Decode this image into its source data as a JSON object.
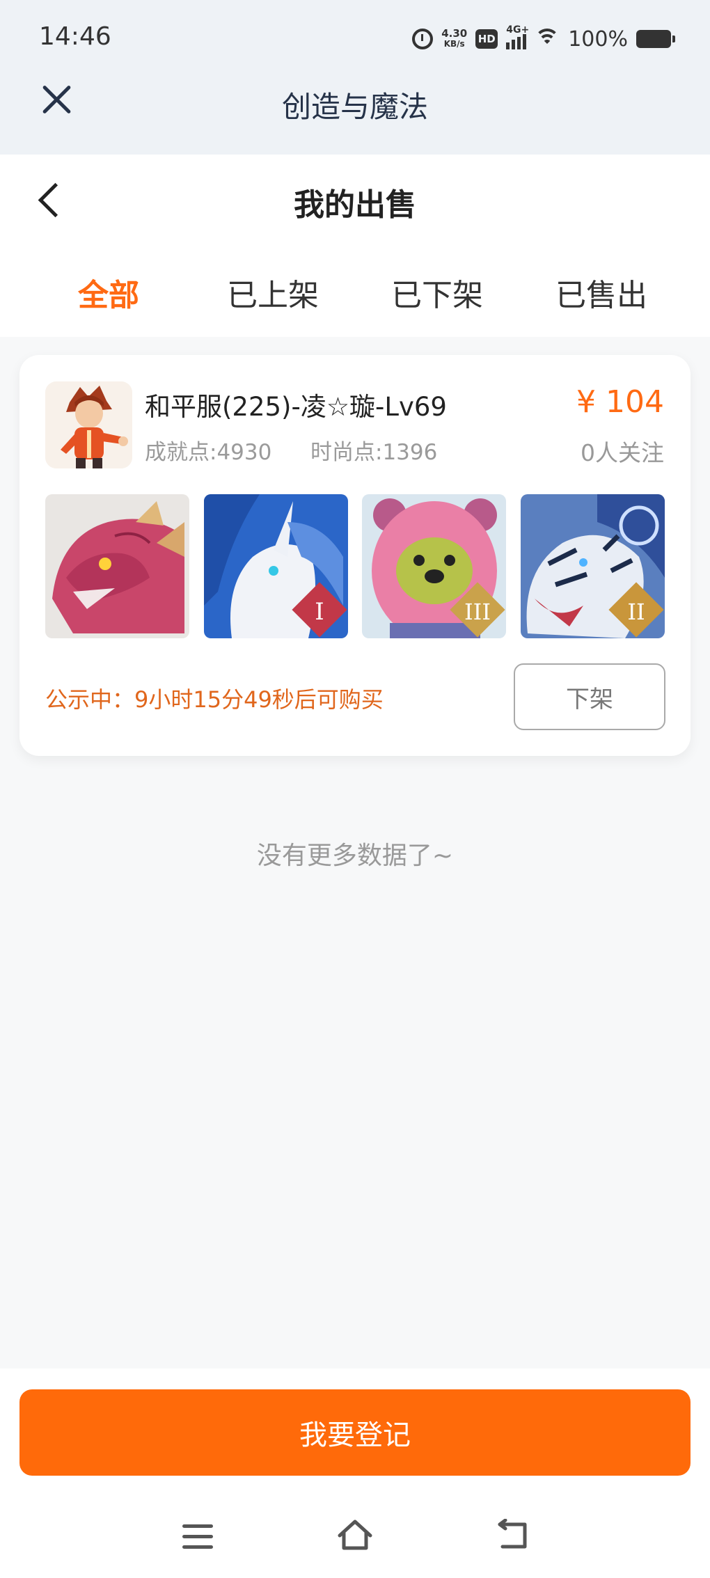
{
  "status_bar": {
    "time": "14:46",
    "net_speed_value": "4.30",
    "net_speed_unit": "KB/s",
    "hd_label": "HD",
    "network_label": "4G+",
    "battery_percent": "100%"
  },
  "app_header": {
    "title": "创造与魔法"
  },
  "page_header": {
    "title": "我的出售"
  },
  "tabs": [
    {
      "label": "全部",
      "active": true
    },
    {
      "label": "已上架",
      "active": false
    },
    {
      "label": "已下架",
      "active": false
    },
    {
      "label": "已售出",
      "active": false
    }
  ],
  "listing": {
    "title": "和平服(225)-凌☆璇-Lv69",
    "achievement": "成就点:4930",
    "fashion": "时尚点:1396",
    "price": "¥ 104",
    "followers": "0人关注",
    "thumbnails": [
      {
        "name": "red-dragon-mount",
        "badge": ""
      },
      {
        "name": "white-unicorn-mount",
        "badge": "I"
      },
      {
        "name": "pink-bear-mount",
        "badge": "III"
      },
      {
        "name": "white-tiger-mount",
        "badge": "II"
      }
    ],
    "notice": "公示中：9小时15分49秒后可购买",
    "delist_label": "下架"
  },
  "empty_text": "没有更多数据了~",
  "register_label": "我要登记",
  "colors": {
    "accent": "#ff6a13",
    "button": "#ff6a0a",
    "notice": "#e0661c"
  }
}
